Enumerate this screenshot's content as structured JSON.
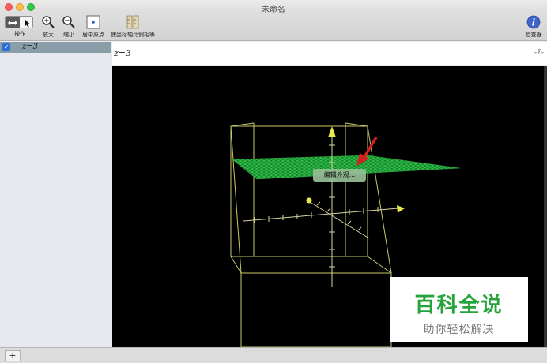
{
  "window": {
    "title": "未命名"
  },
  "toolbar": {
    "operate_label": "操作",
    "zoom_in_label": "放大",
    "zoom_out_label": "缩小",
    "center_origin_label": "居中原点",
    "equal_axes_label": "使坐标轴比例相等",
    "inspector_label": "检查器"
  },
  "sidebar": {
    "objects": [
      {
        "label": "z=3",
        "checked": true
      }
    ]
  },
  "input_bar": {
    "expression": "z=3",
    "sigma_label": "-Σ-"
  },
  "canvas": {
    "context_menu_label": "编辑外观...",
    "plane_color": "#1fa53a",
    "box_color": "#c9c96a",
    "arrow_color": "#d61f1f"
  },
  "watermark": {
    "main": "百科全说",
    "sub": "助你轻松解决"
  },
  "bottom_bar": {
    "add_label": "+"
  }
}
